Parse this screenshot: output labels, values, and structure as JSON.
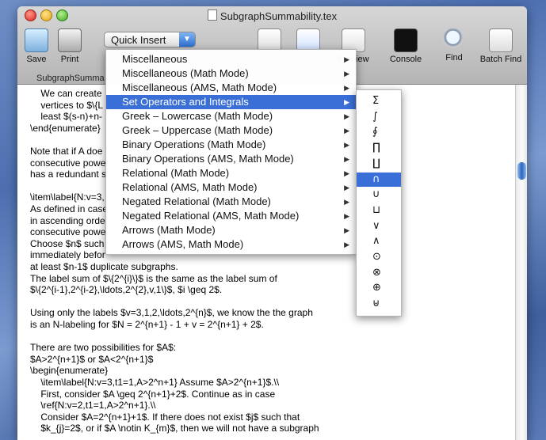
{
  "window": {
    "title": "SubgraphSummability.tex"
  },
  "toolbar": {
    "save_label": "Save",
    "print_label": "Print",
    "quick_insert_label": "Quick Insert",
    "preview_label": "Preview",
    "console_label": "Console",
    "find_label": "Find",
    "batch_find_label": "Batch Find",
    "tab_label": "SubgraphSumma"
  },
  "menu": {
    "items": [
      "Miscellaneous",
      "Miscellaneous (Math Mode)",
      "Miscellaneous (AMS, Math Mode)",
      "Set Operators and Integrals",
      "Greek – Lowercase (Math Mode)",
      "Greek – Uppercase (Math Mode)",
      "Binary Operations (Math Mode)",
      "Binary Operations (AMS, Math Mode)",
      "Relational (Math Mode)",
      "Relational (AMS, Math Mode)",
      "Negated Relational (Math Mode)",
      "Negated Relational (AMS, Math Mode)",
      "Arrows (Math Mode)",
      "Arrows (AMS, Math Mode)"
    ],
    "selected_index": 3
  },
  "submenu": {
    "items": [
      "Σ",
      "∫",
      "∮",
      "∏",
      "∐",
      "∩",
      "∪",
      "⊔",
      "∨",
      "∧",
      "⊙",
      "⊗",
      "⊕",
      "⊎"
    ],
    "selected_index": 5
  },
  "editor_lines": [
    "    We can create",
    "    vertices to $\\{L",
    "    least $(s-n)+n-",
    "\\end{enumerate}",
    "",
    "Note that if A doe",
    "consecutive powe",
    "has a redundant s",
    "",
    "\\item\\label{N:v=3,",
    "As defined in case",
    "in ascending orde",
    "consecutive powe",
    "Choose $n$ such",
    "immediately befor",
    "at least $n-1$ duplicate subgraphs.",
    "The label sum of $\\{2^{i}\\}$ is the same as the label sum of",
    "$\\{2^{i-1},2^{i-2},\\ldots,2^{2},v,1\\}$, $i \\geq 2$.",
    "",
    "Using only the labels $v=3,1,2,\\ldots,2^{n}$, we know the the graph",
    "is an N-labeling for $N = 2^{n+1} - 1 + v = 2^{n+1} + 2$.",
    "",
    "There are two possibilities for $A$:",
    "$A>2^{n+1}$ or $A<2^{n+1}$",
    "\\begin{enumerate}",
    "    \\item\\label{N:v=3,t1=1,A>2^n+1} Assume $A>2^{n+1}$.\\\\",
    "    First, consider $A \\geq 2^{n+1}+2$. Continue as in case",
    "    \\ref{N:v=2,t1=1,A>2^n+1}.\\\\",
    "    Consider $A=2^{n+1}+1$. If there does not exist $j$ such that",
    "    $k_{j}=2$, or if $A \\notin K_{m}$, then we will not have a subgraph"
  ]
}
